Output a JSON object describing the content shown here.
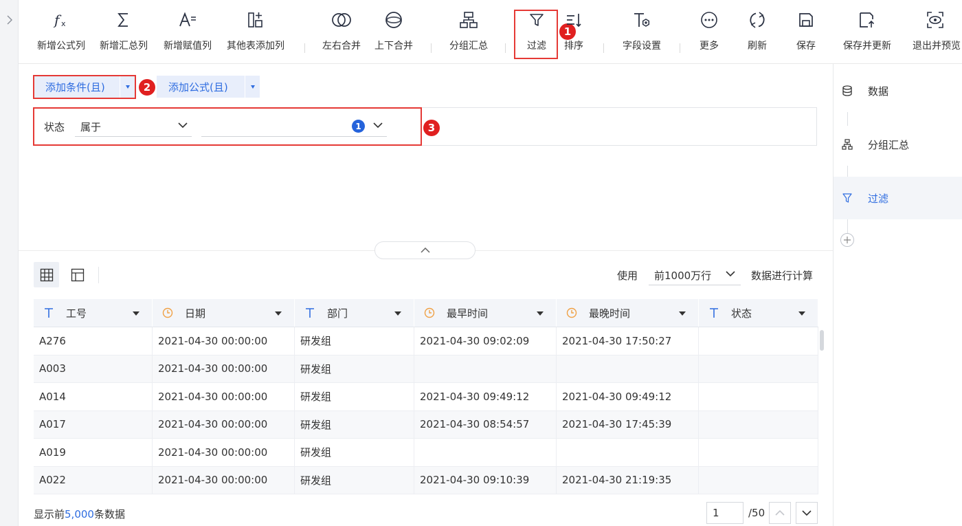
{
  "toolbar": {
    "items": [
      {
        "label": "新增公式列",
        "icon": "formula-icon"
      },
      {
        "label": "新增汇总列",
        "icon": "sigma-icon"
      },
      {
        "label": "新增赋值列",
        "icon": "assign-icon"
      },
      {
        "label": "其他表添加列",
        "icon": "add-column-icon"
      },
      {
        "label": "左右合并",
        "icon": "merge-horizontal-icon"
      },
      {
        "label": "上下合并",
        "icon": "merge-vertical-icon"
      },
      {
        "label": "分组汇总",
        "icon": "group-icon"
      },
      {
        "label": "过滤",
        "icon": "filter-icon"
      },
      {
        "label": "排序",
        "icon": "sort-icon"
      },
      {
        "label": "字段设置",
        "icon": "field-settings-icon"
      },
      {
        "label": "更多",
        "icon": "more-icon"
      },
      {
        "label": "刷新",
        "icon": "refresh-icon"
      },
      {
        "label": "保存",
        "icon": "save-icon"
      },
      {
        "label": "保存并更新",
        "icon": "save-update-icon"
      },
      {
        "label": "退出并预览",
        "icon": "exit-preview-icon"
      }
    ]
  },
  "annotations": [
    "1",
    "2",
    "3"
  ],
  "condition_panel": {
    "add_condition_label": "添加条件(且)",
    "add_formula_label": "添加公式(且)",
    "condition": {
      "field": "状态",
      "operator": "属于",
      "selected_count": "1"
    }
  },
  "data_panel": {
    "row_limit_prefix": "使用",
    "row_limit_value": "前1000万行",
    "row_limit_suffix": "数据进行计算"
  },
  "table": {
    "columns": [
      {
        "name": "工号",
        "type": "text"
      },
      {
        "name": "日期",
        "type": "date"
      },
      {
        "name": "部门",
        "type": "text"
      },
      {
        "name": "最早时间",
        "type": "date"
      },
      {
        "name": "最晚时间",
        "type": "date"
      },
      {
        "name": "状态",
        "type": "text"
      }
    ],
    "rows": [
      [
        "A276",
        "2021-04-30 00:00:00",
        "研发组",
        "2021-04-30 09:02:09",
        "2021-04-30 17:50:27",
        ""
      ],
      [
        "A003",
        "2021-04-30 00:00:00",
        "研发组",
        "",
        "",
        ""
      ],
      [
        "A014",
        "2021-04-30 00:00:00",
        "研发组",
        "2021-04-30 09:49:12",
        "2021-04-30 09:49:12",
        ""
      ],
      [
        "A017",
        "2021-04-30 00:00:00",
        "研发组",
        "2021-04-30 08:54:57",
        "2021-04-30 17:45:39",
        ""
      ],
      [
        "A019",
        "2021-04-30 00:00:00",
        "研发组",
        "",
        "",
        ""
      ],
      [
        "A022",
        "2021-04-30 00:00:00",
        "研发组",
        "2021-04-30 09:10:39",
        "2021-04-30 21:19:35",
        ""
      ]
    ]
  },
  "footer": {
    "prefix": "显示前",
    "count": "5,000",
    "suffix": "条数据",
    "page_current": "1",
    "page_total": "/50"
  },
  "right_panel": {
    "steps": [
      {
        "label": "数据",
        "icon": "database-icon"
      },
      {
        "label": "分组汇总",
        "icon": "group-icon"
      },
      {
        "label": "过滤",
        "icon": "filter-icon"
      }
    ]
  },
  "colors": {
    "accent": "#2f6de0",
    "annotation": "#e02020",
    "highlight_border": "#e53935"
  }
}
